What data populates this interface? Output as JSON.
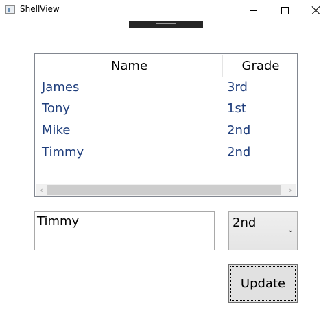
{
  "window": {
    "title": "ShellView"
  },
  "listview": {
    "columns": [
      "Name",
      "Grade"
    ],
    "rows": [
      {
        "name": "James",
        "grade": "3rd"
      },
      {
        "name": "Tony",
        "grade": "1st"
      },
      {
        "name": "Mike",
        "grade": "2nd"
      },
      {
        "name": "Timmy",
        "grade": "2nd"
      }
    ]
  },
  "form": {
    "name_value": "Timmy",
    "grade_selected": "2nd",
    "update_label": "Update"
  }
}
